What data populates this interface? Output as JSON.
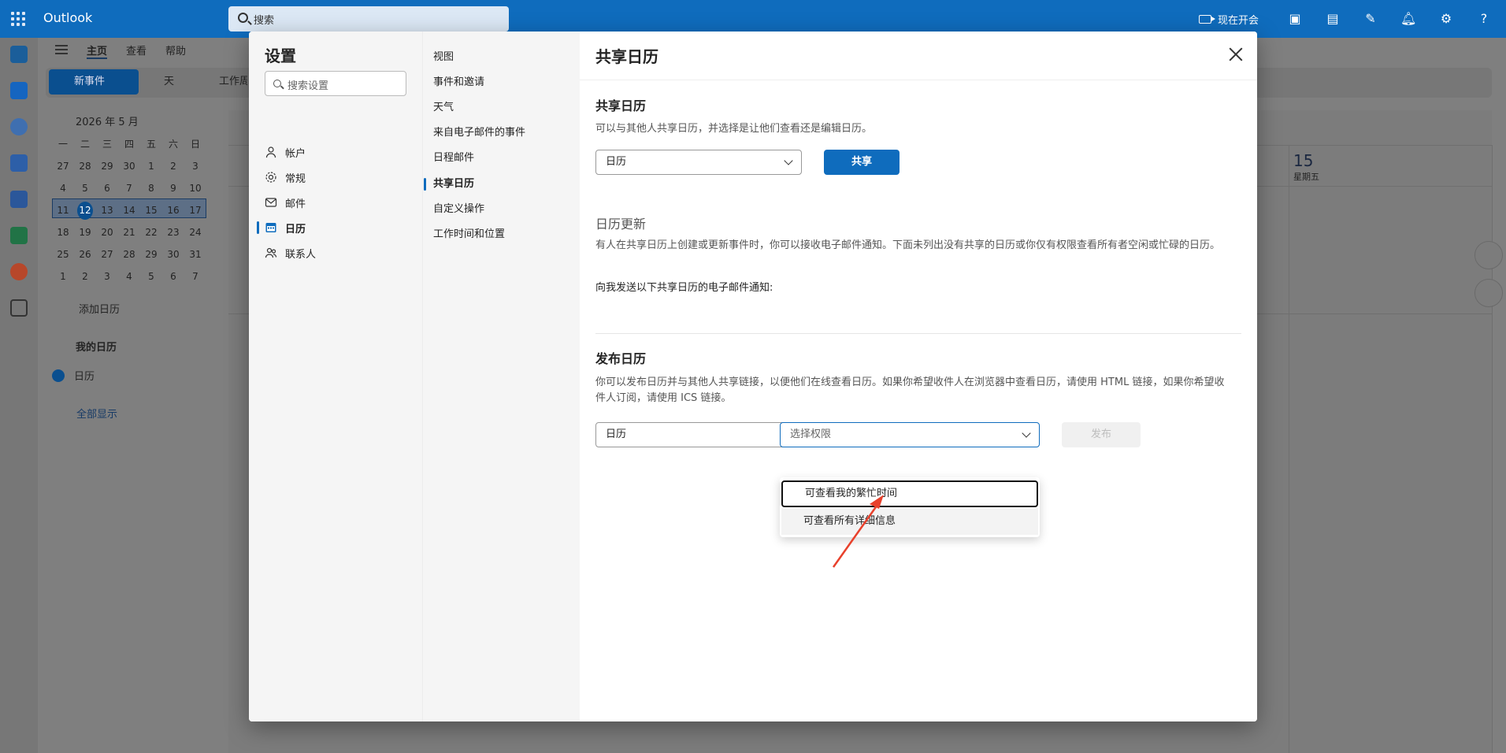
{
  "app": {
    "name": "Outlook",
    "search_placeholder": "搜索",
    "meet_now": "现在开会",
    "colors": {
      "brand": "#0f6cbd",
      "arrow": "#e8412c"
    }
  },
  "ribbon": {
    "tabs": [
      "主页",
      "查看",
      "帮助"
    ],
    "new_event": "新事件",
    "view_day": "天",
    "work_week": "工作周"
  },
  "mini_calendar": {
    "title": "2026 年 5 月",
    "weekdays": [
      "一",
      "二",
      "三",
      "四",
      "五",
      "六",
      "日"
    ],
    "weeks": [
      [
        "27",
        "28",
        "29",
        "30",
        "1",
        "2",
        "3"
      ],
      [
        "4",
        "5",
        "6",
        "7",
        "8",
        "9",
        "10"
      ],
      [
        "11",
        "12",
        "13",
        "14",
        "15",
        "16",
        "17"
      ],
      [
        "18",
        "19",
        "20",
        "21",
        "22",
        "23",
        "24"
      ],
      [
        "25",
        "26",
        "27",
        "28",
        "29",
        "30",
        "31"
      ],
      [
        "1",
        "2",
        "3",
        "4",
        "5",
        "6",
        "7"
      ]
    ],
    "today": "12",
    "selected_week_index": 2
  },
  "calendar_sidebar": {
    "add_calendar": "添加日历",
    "my_calendars": "我的日历",
    "calendar_item": "日历",
    "show_all": "全部显示"
  },
  "calendar_view": {
    "day_number": "15",
    "day_name": "星期五"
  },
  "settings": {
    "title": "设置",
    "search_placeholder": "搜索设置",
    "nav": [
      {
        "label": "帐户",
        "icon": "person-icon"
      },
      {
        "label": "常规",
        "icon": "gear-icon"
      },
      {
        "label": "邮件",
        "icon": "mail-icon"
      },
      {
        "label": "日历",
        "icon": "calendar-icon",
        "active": true
      },
      {
        "label": "联系人",
        "icon": "people-icon"
      }
    ],
    "subnav": [
      "视图",
      "事件和邀请",
      "天气",
      "来自电子邮件的事件",
      "日程邮件",
      "共享日历",
      "自定义操作",
      "工作时间和位置"
    ],
    "subnav_active": "共享日历"
  },
  "shared_calendar": {
    "page_title": "共享日历",
    "share_section": {
      "heading": "共享日历",
      "description": "可以与其他人共享日历，并选择是让他们查看还是编辑日历。",
      "calendar_select": "日历",
      "share_button": "共享"
    },
    "updates_section": {
      "heading": "日历更新",
      "description": "有人在共享日历上创建或更新事件时，你可以接收电子邮件通知。下面未列出没有共享的日历或你仅有权限查看所有者空闲或忙碌的日历。",
      "notify_label": "向我发送以下共享日历的电子邮件通知:"
    },
    "publish_section": {
      "heading": "发布日历",
      "description": "你可以发布日历并与其他人共享链接，以便他们在线查看日历。如果你希望收件人在浏览器中查看日历，请使用 HTML 链接，如果你希望收件人订阅，请使用 ICS 链接。",
      "calendar_select": "日历",
      "permission_placeholder": "选择权限",
      "publish_button": "发布",
      "permission_options": [
        "可查看我的繁忙时间",
        "可查看所有详细信息"
      ]
    }
  }
}
